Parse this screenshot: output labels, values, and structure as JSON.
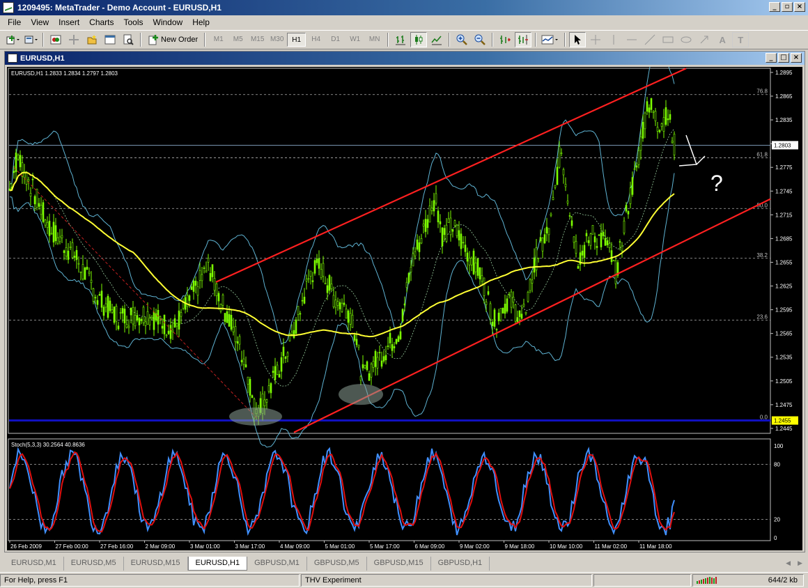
{
  "window": {
    "title": "1209495: MetaTrader - Demo Account - EURUSD,H1"
  },
  "menu": [
    "File",
    "View",
    "Insert",
    "Charts",
    "Tools",
    "Window",
    "Help"
  ],
  "toolbar": {
    "new_order_label": "New Order",
    "timeframes": [
      "M1",
      "M5",
      "M15",
      "M30",
      "H1",
      "H4",
      "D1",
      "W1",
      "MN"
    ],
    "active_timeframe": "H1",
    "right_text_tool": "A",
    "right_label_tool": "T"
  },
  "chart_window": {
    "title": "EURUSD,H1"
  },
  "main_chart": {
    "info": "EURUSD,H1  1.2833 1.2834 1.2797 1.2803",
    "price_labels": [
      "1.2895",
      "1.2865",
      "1.2835",
      "1.2805",
      "1.2775",
      "1.2745",
      "1.2715",
      "1.2685",
      "1.2655",
      "1.2625",
      "1.2595",
      "1.2565",
      "1.2535",
      "1.2505",
      "1.2475",
      "1.2445"
    ],
    "current_price": "1.2803",
    "support_price": "1.2455",
    "fib_levels": [
      {
        "label": "76.8",
        "price": 1.2867
      },
      {
        "label": "61.8",
        "price": 1.2787
      },
      {
        "label": "50.0",
        "price": 1.2723
      },
      {
        "label": "38.2",
        "price": 1.266
      },
      {
        "label": "23.6",
        "price": 1.2582
      },
      {
        "label": "0.0",
        "price": 1.2455
      }
    ],
    "question_mark": "?"
  },
  "stoch": {
    "info": "Stoch(5,3,3) 30.2564 40.8636",
    "levels": [
      "100",
      "80",
      "20",
      "0"
    ]
  },
  "time_labels": [
    "26 Feb 2009",
    "27 Feb 00:00",
    "27 Feb 16:00",
    "2 Mar 09:00",
    "3 Mar 01:00",
    "3 Mar 17:00",
    "4 Mar 09:00",
    "5 Mar 01:00",
    "5 Mar 17:00",
    "6 Mar 09:00",
    "9 Mar 02:00",
    "9 Mar 18:00",
    "10 Mar 10:00",
    "11 Mar 02:00",
    "11 Mar 18:00"
  ],
  "tabs": [
    "EURUSD,M1",
    "EURUSD,M5",
    "EURUSD,M15",
    "EURUSD,H1",
    "GBPUSD,M1",
    "GBPUSD,M5",
    "GBPUSD,M15",
    "GBPUSD,H1"
  ],
  "active_tab": "EURUSD,H1",
  "status": {
    "help": "For Help, press F1",
    "profile": "THV Experiment",
    "traffic": "644/2 kb"
  },
  "colors": {
    "candles": "#7cfc00",
    "ma": "#ffff33",
    "bands": "#5fb4d4",
    "channel": "#ff2020",
    "support": "#1010c0",
    "stoch_main": "#4090ff",
    "stoch_signal": "#e01010"
  }
}
